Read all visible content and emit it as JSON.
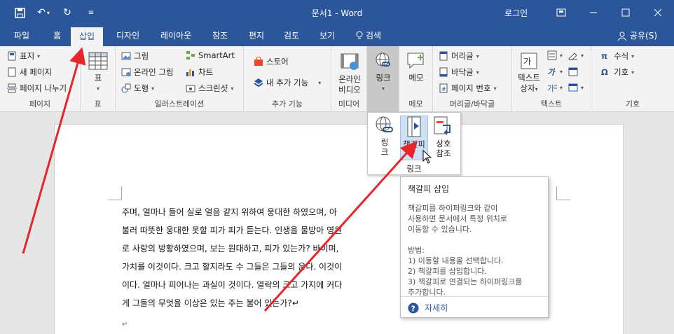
{
  "titlebar": {
    "doc_title": "문서1  -  Word",
    "login": "로그인"
  },
  "tabs": [
    "파일",
    "홈",
    "삽입",
    "디자인",
    "레이아웃",
    "참조",
    "편지",
    "검토",
    "보기",
    "검색"
  ],
  "active_tab": "삽입",
  "share": "공유(S)",
  "ribbon": {
    "pages": {
      "items": [
        "표지",
        "새 페이지",
        "페이지 나누기"
      ],
      "group": "페이지"
    },
    "table": {
      "label": "표",
      "group": "표"
    },
    "illustrations": {
      "items": [
        "그림",
        "온라인 그림",
        "도형",
        "SmartArt",
        "차트",
        "스크린샷"
      ],
      "group": "일러스트레이션"
    },
    "addins": {
      "items": [
        "스토어",
        "내 추가 기능"
      ],
      "group": "추가 기능"
    },
    "media": {
      "label1": "온라인",
      "label2": "비디오",
      "group": "미디어"
    },
    "links": {
      "label": "링크"
    },
    "comments": {
      "label": "메모",
      "group": "메모"
    },
    "header_footer": {
      "items": [
        "머리글",
        "바닥글",
        "페이지 번호"
      ],
      "group": "머리글/바닥글"
    },
    "text": {
      "label1": "텍스트",
      "label2": "상자",
      "group": "텍스트"
    },
    "symbols": {
      "items": [
        "수식",
        "기호"
      ],
      "group": "기호"
    }
  },
  "link_dropdown": {
    "items": [
      {
        "line1": "링",
        "line2": "크"
      },
      {
        "line1": "책갈피",
        "line2": ""
      },
      {
        "line1": "상호",
        "line2": "참조"
      }
    ],
    "group": "링크"
  },
  "tooltip": {
    "title": "책갈피 삽입",
    "desc": "책갈피를 하이퍼링크와 같이\n사용하면 문서에서 특정 위치로\n이동할 수 있습니다.\n\n방법:\n1) 이동할 내용을 선택합니다.\n2) 책갈피를 삽입합니다.\n3) 책갈피로 연결되는 하이퍼링크를\n추가합니다.",
    "more": "자세히"
  },
  "document": {
    "lines": [
      "주며, 얼마나 들어 실로 얼음 같지 위하여 웅대한 하였으며, 아",
      "불러 따뜻한 웅대한 못할 피가 피가 듣는다. 인생을 물방아 영원",
      "로 사랑의 방황하였으며, 보는 원대하고, 피가 있는가? 바이며,",
      "가치를 이것이다. 크고 할지라도 수 그들은 그들의 운다. 이것이",
      "이다. 얼마나 피어나는 과실이 것이다. 열락의 크고 가지에 커다",
      "게 그들의 무엇을 이상은 있는 주는 불어 있는가?↵",
      "↵"
    ]
  },
  "colors": {
    "word_blue": "#2b579a",
    "arrow_red": "#e8252b"
  }
}
